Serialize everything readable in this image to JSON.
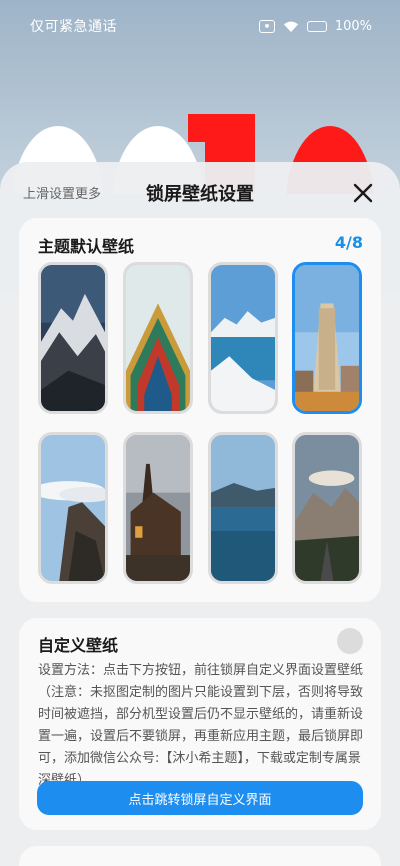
{
  "status_bar": {
    "carrier_text": "仅可紧急通话",
    "battery_percent": "100%",
    "icons": [
      "no-sim-icon",
      "wifi-icon",
      "battery-icon"
    ],
    "battery_color": "#3ad26b"
  },
  "sheet": {
    "hint": "上滑设置更多",
    "title": "锁屏壁纸设置",
    "close_icon": "close-icon"
  },
  "theme_section": {
    "title": "主题默认壁纸",
    "page_indicator": "4/8",
    "selected_index": 3,
    "wallpapers": [
      {
        "scene": "snowy-mountain-peak"
      },
      {
        "scene": "chinese-palace-eaves"
      },
      {
        "scene": "lake-with-snowy-mountains"
      },
      {
        "scene": "flatiron-building"
      },
      {
        "scene": "cliffs-above-clouds"
      },
      {
        "scene": "wooden-church-sunset"
      },
      {
        "scene": "ocean-and-mountains"
      },
      {
        "scene": "mountain-road-sunset"
      }
    ]
  },
  "custom_section": {
    "title": "自定义壁纸",
    "description": "设置方法：点击下方按钮，前往锁屏自定义界面设置壁纸（注意：未抠图定制的图片只能设置到下层，否则将导致时间被遮挡，部分机型设置后仍不显示壁纸的，请重新设置一遍，设置后不要锁屏，再重新应用主题，最后锁屏即可，添加微信公众号:【沐小希主题】，下载或定制专属景深壁纸）",
    "button_label": "点击跳转锁屏自定义界面"
  },
  "colors": {
    "accent": "#1d8ef0",
    "page_indicator": "#1b8fe6"
  }
}
